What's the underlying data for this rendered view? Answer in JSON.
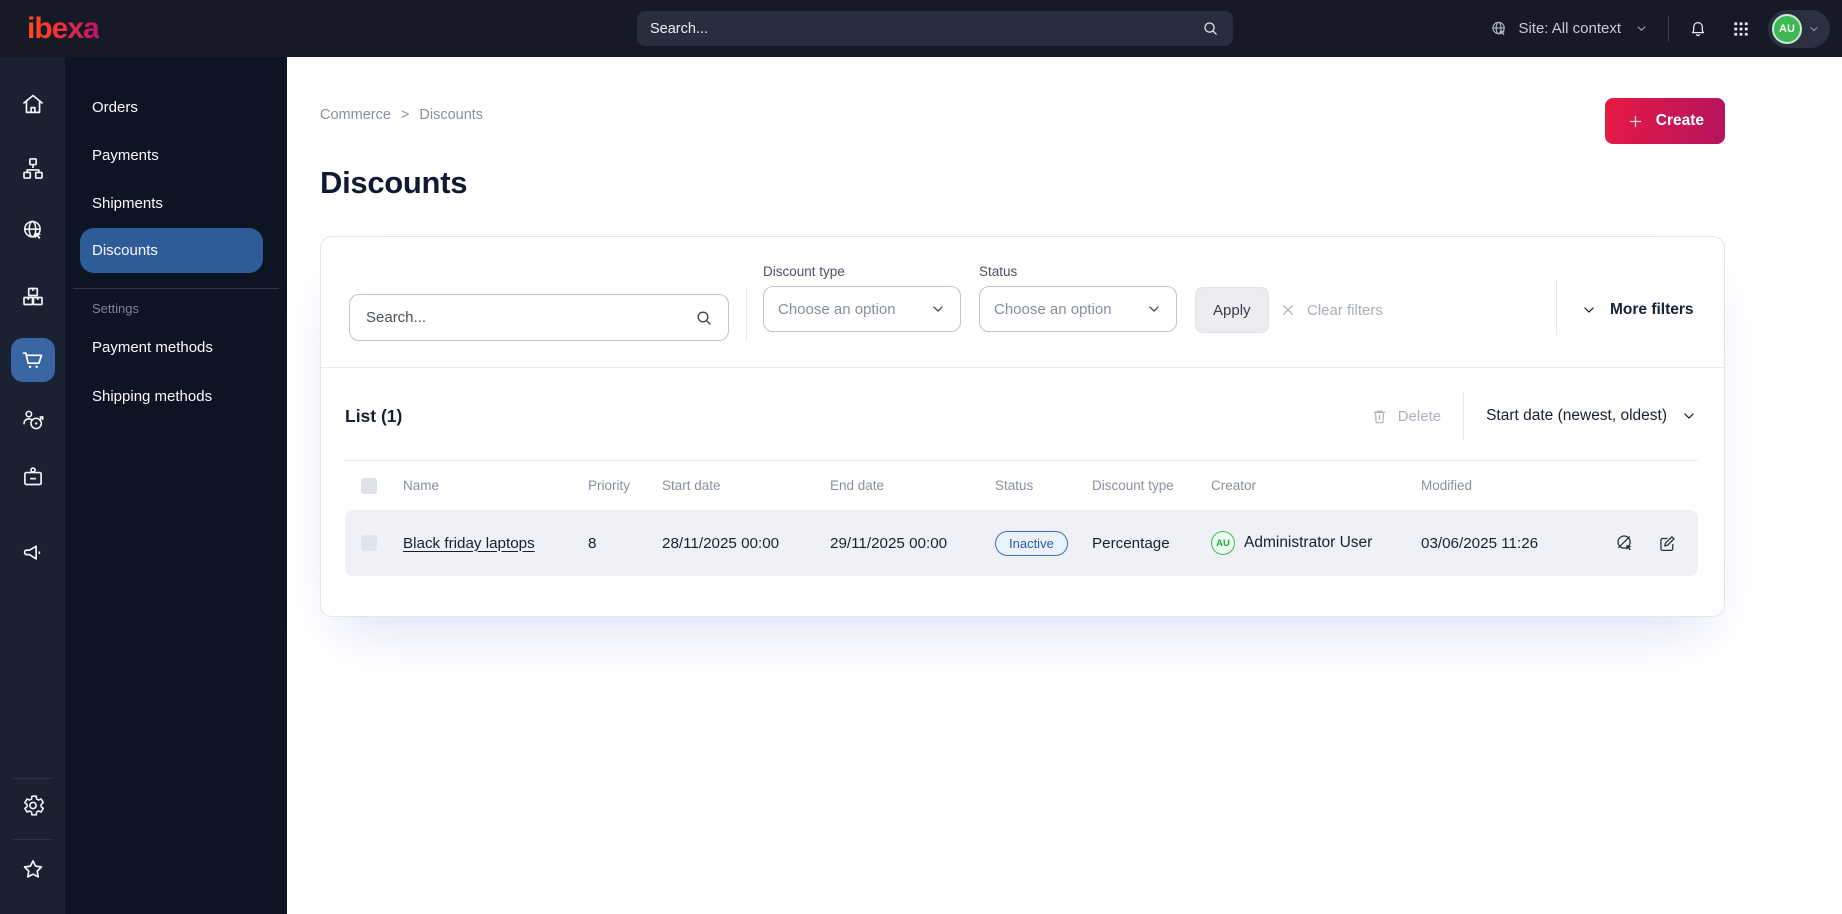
{
  "colors": {
    "brand_gradient_start": "#E61A43",
    "brand_gradient_end": "#B4145F",
    "topbar_bg": "#151A26",
    "rail_bg": "#1A2130",
    "menu_bg": "#0D1422",
    "active_item_bg": "#2D5C99",
    "active_rail_bg": "#3A67A3",
    "status_inactive_bg": "#EAF2FC",
    "status_inactive_border": "#3D72BC",
    "status_inactive_text": "#2B5BA8",
    "avatar_green": "#3DBD57"
  },
  "topbar": {
    "logo_text": "ibexa",
    "search_placeholder": "Search...",
    "site_context_label": "Site: All context",
    "avatar_initials": "AU"
  },
  "rail": {
    "icons": [
      "home-icon",
      "sitemap-icon",
      "site-preview-globe-icon",
      "products-boxes-icon",
      "commerce-cart-icon",
      "segments-target-icon",
      "id-badge-icon",
      "megaphone-icon",
      "settings-gear-icon",
      "bookmarks-star-icon"
    ],
    "active": "commerce-cart-icon"
  },
  "menu": {
    "items": [
      {
        "label": "Orders"
      },
      {
        "label": "Payments"
      },
      {
        "label": "Shipments"
      },
      {
        "label": "Discounts",
        "active": true
      }
    ],
    "section_label": "Settings",
    "section_items": [
      {
        "label": "Payment methods"
      },
      {
        "label": "Shipping methods"
      }
    ]
  },
  "breadcrumb": {
    "items": [
      "Commerce",
      "Discounts"
    ],
    "separator": ">"
  },
  "page": {
    "title": "Discounts"
  },
  "actions": {
    "create_label": "Create"
  },
  "filters": {
    "search_placeholder": "Search...",
    "discount_type": {
      "label": "Discount type",
      "value": "Choose an option"
    },
    "status": {
      "label": "Status",
      "value": "Choose an option"
    },
    "apply_label": "Apply",
    "clear_label": "Clear filters",
    "more_label": "More filters"
  },
  "list": {
    "title": "List (1)",
    "delete_label": "Delete",
    "sort_label": "Start date (newest, oldest)",
    "columns": [
      "Name",
      "Priority",
      "Start date",
      "End date",
      "Status",
      "Discount type",
      "Creator",
      "Modified"
    ],
    "rows": [
      {
        "name": "Black friday laptops",
        "priority": "8",
        "start_date": "28/11/2025 00:00",
        "end_date": "29/11/2025 00:00",
        "status": "Inactive",
        "discount_type": "Percentage",
        "creator": {
          "initials": "AU",
          "name": "Administrator User"
        },
        "modified": "03/06/2025 11:26"
      }
    ]
  }
}
